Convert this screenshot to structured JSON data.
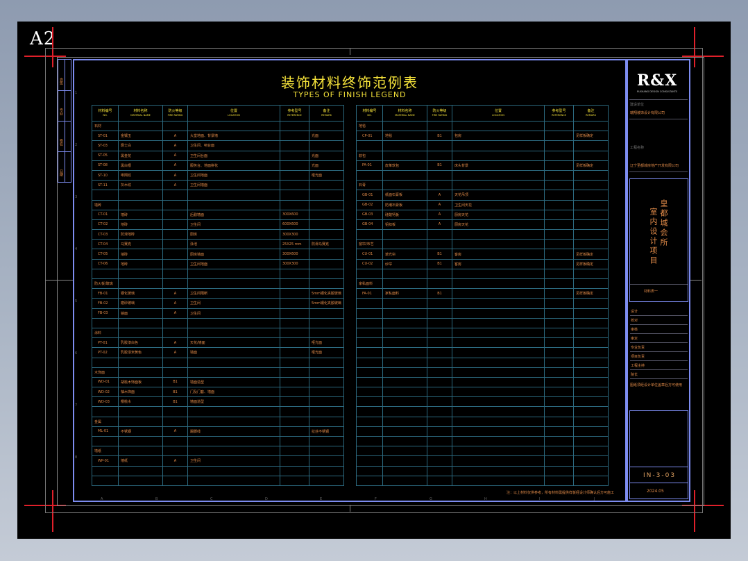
{
  "sheet": {
    "size_label": "A2"
  },
  "title": {
    "cn": "装饰材料终饰范例表",
    "en": "TYPES OF FINISH LEGEND"
  },
  "headers": [
    {
      "cn": "材料编号",
      "en": "NO."
    },
    {
      "cn": "材料名称",
      "en": "MATERIAL NAME"
    },
    {
      "cn": "防火等级",
      "en": "FIRE RATING"
    },
    {
      "cn": "位置",
      "en": "LOCATION"
    },
    {
      "cn": "参考型号",
      "en": "REFERENCE"
    },
    {
      "cn": "备注",
      "en": "REMARK"
    }
  ],
  "left_rows": [
    [
      "石材",
      "",
      "",
      "",
      "",
      ""
    ],
    [
      "ST-01",
      "金镶玉",
      "A",
      "大堂地面、背景墙",
      "",
      "光面"
    ],
    [
      "ST-03",
      "爵士白",
      "A",
      "卫生间、吧台面",
      "",
      ""
    ],
    [
      "ST-05",
      "黑金花",
      "A",
      "卫生间台面",
      "",
      "光面"
    ],
    [
      "ST-08",
      "黑白根",
      "A",
      "服务台、地面拼花",
      "",
      "光面"
    ],
    [
      "ST-10",
      "啡网纹",
      "A",
      "卫生间地面",
      "",
      "哑光面"
    ],
    [
      "ST-11",
      "灰木纹",
      "A",
      "卫生间墙面",
      "",
      ""
    ],
    [
      "",
      "",
      "",
      "",
      "",
      ""
    ],
    [
      "墙砖",
      "",
      "",
      "",
      "",
      ""
    ],
    [
      "CT-01",
      "墙砖",
      "",
      "后勤墙面",
      "300X600",
      ""
    ],
    [
      "CT-02",
      "地砖",
      "",
      "卫生间",
      "600X600",
      ""
    ],
    [
      "CT-03",
      "防滑地砖",
      "",
      "厨房",
      "300X300",
      ""
    ],
    [
      "CT-04",
      "马赛克",
      "",
      "泳池",
      "25X25 mm",
      "防滑马赛克"
    ],
    [
      "CT-05",
      "墙砖",
      "",
      "厨房墙面",
      "300X600",
      ""
    ],
    [
      "CT-06",
      "地砖",
      "",
      "卫生间地面",
      "300X300",
      ""
    ],
    [
      "",
      "",
      "",
      "",
      "",
      ""
    ],
    [
      "防火板/玻璃",
      "",
      "",
      "",
      "",
      ""
    ],
    [
      "FB-01",
      "钢化玻璃",
      "A",
      "卫生间隔断",
      "",
      "5mm钢化夹胶玻璃"
    ],
    [
      "FB-02",
      "磨砂玻璃",
      "A",
      "卫生间",
      "",
      "5mm钢化夹胶玻璃"
    ],
    [
      "FB-03",
      "镜面",
      "A",
      "卫生间",
      "",
      ""
    ],
    [
      "",
      "",
      "",
      "",
      "",
      ""
    ],
    [
      "涂料",
      "",
      "",
      "",
      "",
      ""
    ],
    [
      "PT-01",
      "乳胶漆白色",
      "A",
      "天花/墙面",
      "",
      "哑光面"
    ],
    [
      "PT-02",
      "乳胶漆米黄色",
      "A",
      "墙面",
      "",
      "哑光面"
    ],
    [
      "",
      "",
      "",
      "",
      "",
      ""
    ],
    [
      "木饰面",
      "",
      "",
      "",
      "",
      ""
    ],
    [
      "WD-01",
      "胡桃木饰面板",
      "B1",
      "墙面造型",
      "",
      ""
    ],
    [
      "WD-02",
      "柚木饰面",
      "B1",
      "门及门套、墙面",
      "",
      ""
    ],
    [
      "WD-03",
      "樱桃木",
      "B1",
      "墙面造型",
      "",
      ""
    ],
    [
      "",
      "",
      "",
      "",
      "",
      ""
    ],
    [
      "金属",
      "",
      "",
      "",
      "",
      ""
    ],
    [
      "ML-01",
      "不锈钢",
      "A",
      "踢脚线",
      "",
      "拉丝不锈钢"
    ],
    [
      "",
      "",
      "",
      "",
      "",
      ""
    ],
    [
      "墙纸",
      "",
      "",
      "",
      "",
      ""
    ],
    [
      "WP-01",
      "墙纸",
      "A",
      "卫生间",
      "",
      ""
    ],
    [
      "",
      "",
      "",
      "",
      "",
      ""
    ],
    [
      "",
      "",
      "",
      "",
      "",
      ""
    ]
  ],
  "right_rows": [
    [
      "地毯",
      "",
      "",
      "",
      "",
      ""
    ],
    [
      "CP-01",
      "地毯",
      "B1",
      "包房",
      "",
      "见样板确定"
    ],
    [
      "",
      "",
      "",
      "",
      "",
      ""
    ],
    [
      "软包",
      "",
      "",
      "",
      "",
      ""
    ],
    [
      "FA-01",
      "皮革软包",
      "B1",
      "床头背景",
      "",
      "见样板确定"
    ],
    [
      "",
      "",
      "",
      "",
      "",
      ""
    ],
    [
      "石膏",
      "",
      "",
      "",
      "",
      ""
    ],
    [
      "GB-01",
      "纸面石膏板",
      "A",
      "天花吊顶",
      "",
      ""
    ],
    [
      "GB-02",
      "防潮石膏板",
      "A",
      "卫生间天花",
      "",
      ""
    ],
    [
      "GB-03",
      "硅酸钙板",
      "A",
      "厨房天花",
      "",
      ""
    ],
    [
      "GB-04",
      "铝扣板",
      "A",
      "厨房天花",
      "",
      ""
    ],
    [
      "",
      "",
      "",
      "",
      "",
      ""
    ],
    [
      "窗帘/布艺",
      "",
      "",
      "",
      "",
      ""
    ],
    [
      "CU-01",
      "遮光帘",
      "B1",
      "客房",
      "",
      "见样板确定"
    ],
    [
      "CU-02",
      "纱帘",
      "B1",
      "客房",
      "",
      "见样板确定"
    ],
    [
      "",
      "",
      "",
      "",
      "",
      ""
    ],
    [
      "家私面料",
      "",
      "",
      "",
      "",
      ""
    ],
    [
      "FA-01",
      "家私面料",
      "B1",
      "",
      "",
      "见样板确定"
    ],
    [
      "",
      "",
      "",
      "",
      "",
      ""
    ],
    [
      "",
      "",
      "",
      "",
      "",
      ""
    ],
    [
      "",
      "",
      "",
      "",
      "",
      ""
    ],
    [
      "",
      "",
      "",
      "",
      "",
      ""
    ],
    [
      "",
      "",
      "",
      "",
      "",
      ""
    ],
    [
      "",
      "",
      "",
      "",
      "",
      ""
    ],
    [
      "",
      "",
      "",
      "",
      "",
      ""
    ],
    [
      "",
      "",
      "",
      "",
      "",
      ""
    ],
    [
      "",
      "",
      "",
      "",
      "",
      ""
    ],
    [
      "",
      "",
      "",
      "",
      "",
      ""
    ],
    [
      "",
      "",
      "",
      "",
      "",
      ""
    ],
    [
      "",
      "",
      "",
      "",
      "",
      ""
    ],
    [
      "",
      "",
      "",
      "",
      "",
      ""
    ],
    [
      "",
      "",
      "",
      "",
      "",
      ""
    ],
    [
      "",
      "",
      "",
      "",
      "",
      ""
    ],
    [
      "",
      "",
      "",
      "",
      "",
      ""
    ],
    [
      "",
      "",
      "",
      "",
      "",
      ""
    ],
    [
      "",
      "",
      "",
      "",
      "",
      ""
    ],
    [
      "",
      "",
      "",
      "",
      "",
      ""
    ]
  ],
  "footnote": "注：以上材料仅供参考，所有材料需提供样板经设计师确认后方可施工",
  "titleblock": {
    "logo": "R&X",
    "logo_sub": "RUIXIANG DESIGN CONSULTANTS",
    "company": "瑞翔装饰设计有限公司",
    "client_label": "建设单位",
    "client": "辽宁圣都城房地产开发有限公司",
    "project_label": "工程名称",
    "project_line1": "皇都城会所",
    "project_line2": "室内设计项目",
    "drawing_title": "材料表一",
    "drawing_no": "IN-3-03",
    "date": "2024.05",
    "rows": [
      "设计",
      "校对",
      "审核",
      "审定",
      "专业负责",
      "项目负责",
      "工程主持",
      "院长"
    ],
    "stamp_note": "图纸须经设计单位盖章后方可使用"
  },
  "axis_bottom": [
    "A",
    "B",
    "C",
    "D",
    "E",
    "F",
    "G",
    "H",
    "I",
    "J"
  ],
  "axis_side": [
    "1",
    "2",
    "3",
    "4",
    "5",
    "6",
    "7",
    "8"
  ],
  "side_strip": [
    "会签",
    "专业",
    "签名",
    "日期"
  ]
}
